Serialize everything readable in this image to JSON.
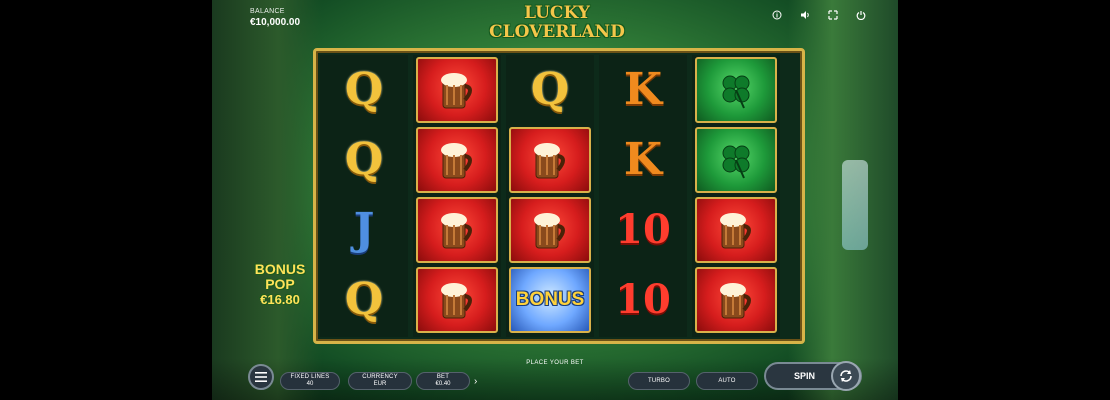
{
  "hud": {
    "balance_label": "BALANCE",
    "balance_value": "€10,000.00",
    "icons": [
      "info-icon",
      "sound-icon",
      "fullscreen-icon",
      "power-icon"
    ]
  },
  "logo": {
    "line1": "LUCKY",
    "line2": "CLOVERLAND"
  },
  "reels": [
    [
      "Q",
      "Q",
      "J",
      "Q"
    ],
    [
      "mug",
      "mug",
      "mug",
      "mug"
    ],
    [
      "Q",
      "mug",
      "mug",
      "BONUS"
    ],
    [
      "K",
      "K",
      "10",
      "10"
    ],
    [
      "clover",
      "clover",
      "mug",
      "mug"
    ]
  ],
  "bonus_pop": {
    "line1": "BONUS",
    "line2": "POP",
    "value": "€16.80"
  },
  "controls": {
    "place_bet": "PLACE YOUR BET",
    "fixed_lines_label": "FIXED LINES",
    "fixed_lines_value": "40",
    "currency_label": "CURRENCY",
    "currency_value": "EUR",
    "bet_label": "BET",
    "bet_value": "€0.40",
    "turbo_label": "TURBO",
    "auto_label": "AUTO",
    "spin_label": "SPIN"
  },
  "colors": {
    "frame_gold": "#d7b448",
    "red_tile": "#d61d1d",
    "green_tile": "#1e9a3a",
    "button_bg": "#2a3640"
  }
}
